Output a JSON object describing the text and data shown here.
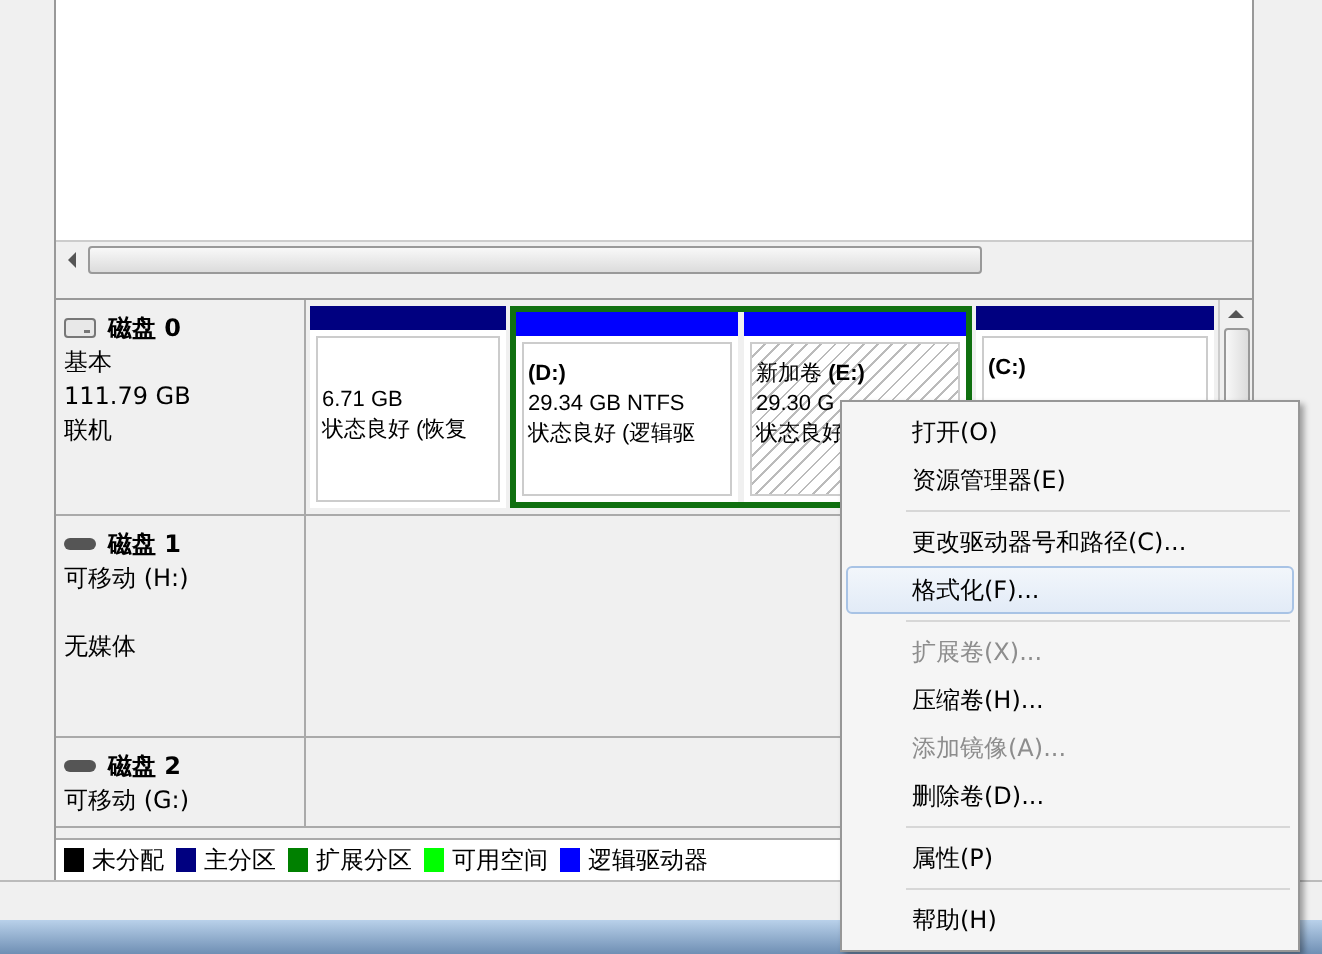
{
  "disks": [
    {
      "name": "磁盘 0",
      "kind": "basic",
      "type": "基本",
      "size": "111.79 GB",
      "status": "联机",
      "partitions": [
        {
          "size": "6.71 GB",
          "status": "状态良好 (恢复",
          "color": "#000080",
          "in_extended": false,
          "selected": false
        },
        {
          "letter": "(D:)",
          "size": "29.34 GB NTFS",
          "status": "状态良好 (逻辑驱",
          "color": "#0000ff",
          "in_extended": true,
          "selected": false
        },
        {
          "letter": "(E:)",
          "name": "新加卷",
          "size": "29.30 G",
          "status": "状态良好",
          "color": "#0000ff",
          "in_extended": true,
          "selected": true
        },
        {
          "letter": "(C:)",
          "color": "#000080",
          "in_extended": false,
          "selected": false
        }
      ]
    },
    {
      "name": "磁盘 1",
      "kind": "removable",
      "type": "可移动 (H:)",
      "status": "无媒体"
    },
    {
      "name": "磁盘 2",
      "kind": "removable",
      "type": "可移动 (G:)"
    }
  ],
  "legend": [
    {
      "label": "未分配",
      "color": "#000000"
    },
    {
      "label": "主分区",
      "color": "#000080"
    },
    {
      "label": "扩展分区",
      "color": "#008000"
    },
    {
      "label": "可用空间",
      "color": "#00ff00"
    },
    {
      "label": "逻辑驱动器",
      "color": "#0000ff"
    }
  ],
  "context_menu": [
    {
      "kind": "item",
      "label": "打开(O)",
      "disabled": false,
      "selected": false
    },
    {
      "kind": "item",
      "label": "资源管理器(E)",
      "disabled": false,
      "selected": false
    },
    {
      "kind": "separator"
    },
    {
      "kind": "item",
      "label": "更改驱动器号和路径(C)...",
      "disabled": false,
      "selected": false
    },
    {
      "kind": "item",
      "label": "格式化(F)...",
      "disabled": false,
      "selected": true
    },
    {
      "kind": "separator"
    },
    {
      "kind": "item",
      "label": "扩展卷(X)...",
      "disabled": true,
      "selected": false
    },
    {
      "kind": "item",
      "label": "压缩卷(H)...",
      "disabled": false,
      "selected": false
    },
    {
      "kind": "item",
      "label": "添加镜像(A)...",
      "disabled": true,
      "selected": false
    },
    {
      "kind": "item",
      "label": "删除卷(D)...",
      "disabled": false,
      "selected": false
    },
    {
      "kind": "separator"
    },
    {
      "kind": "item",
      "label": "属性(P)",
      "disabled": false,
      "selected": false
    },
    {
      "kind": "separator"
    },
    {
      "kind": "item",
      "label": "帮助(H)",
      "disabled": false,
      "selected": false
    }
  ]
}
